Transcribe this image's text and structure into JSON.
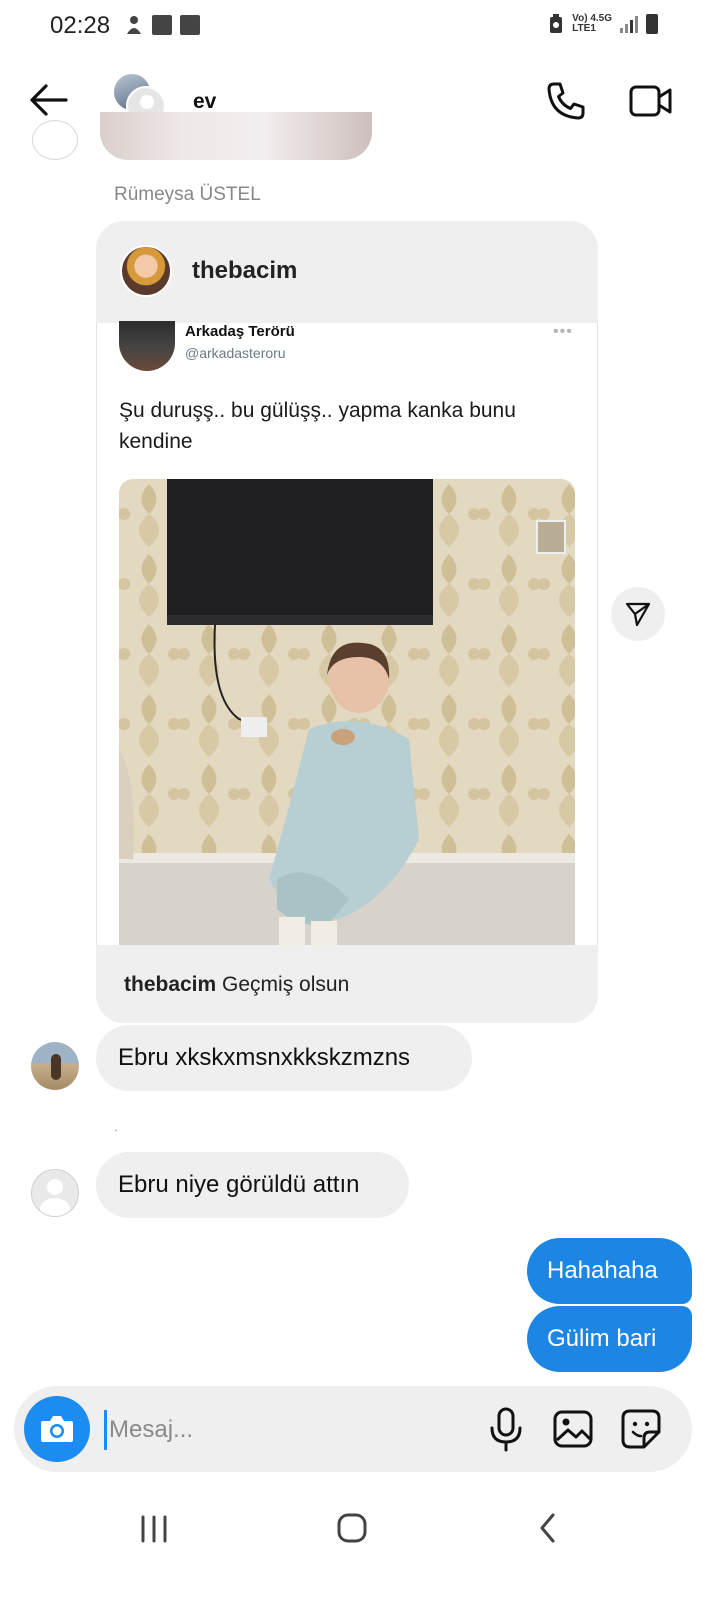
{
  "status_bar": {
    "time": "02:28",
    "network_top": "Vo) 4.5G",
    "network_bottom": "LTE1"
  },
  "header": {
    "title": "ev",
    "back_icon": "arrow-left-icon",
    "call_icon": "phone-icon",
    "video_icon": "video-camera-icon"
  },
  "messages": {
    "sender_name": "Rümeysa ÜSTEL",
    "shared_post": {
      "username": "thebacim",
      "tweet": {
        "author": "Arkadaş Terörü",
        "handle": "@arkadasteroru",
        "more": "•••",
        "text": "Şu duruşş.. bu gülüşş.. yapma kanka bunu kendine"
      },
      "caption_user": "thebacim",
      "caption_text": "Geçmiş olsun"
    },
    "incoming": [
      {
        "text": "Ebru xkskxmsnxkkskzmzns"
      },
      {
        "text": "Ebru niye görüldü attın"
      }
    ],
    "dot": ".",
    "outgoing": [
      {
        "text": "Hahahaha"
      },
      {
        "text": "Gülim bari"
      }
    ]
  },
  "composer": {
    "placeholder": "Mesaj..."
  },
  "colors": {
    "accent": "#1d86e5",
    "incoming_bubble": "#efefef",
    "camera_button": "#1c8cf0"
  }
}
